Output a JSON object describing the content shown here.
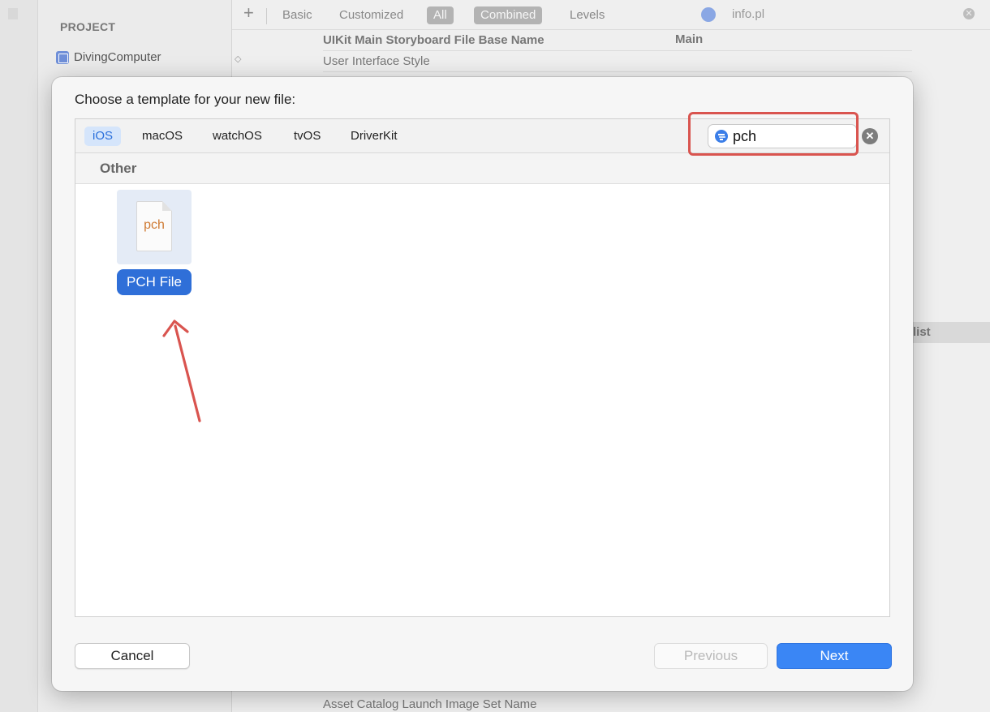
{
  "background": {
    "sidebar": {
      "header": "PROJECT",
      "project_item": "DivingComputer"
    },
    "toolbar": {
      "plus": "+",
      "tabs": [
        "Basic",
        "Customized",
        "All",
        "Combined",
        "Levels"
      ],
      "search_value": "info.pl"
    },
    "rows": {
      "storyboard_key": "UIKit Main Storyboard File Base Name",
      "storyboard_value": "Main",
      "ui_style": "User Interface Style",
      "selected_fragment": "list",
      "asset_catalog": "Asset Catalog Launch Image Set Name"
    }
  },
  "dialog": {
    "title": "Choose a template for your new file:",
    "platform_tabs": [
      "iOS",
      "macOS",
      "watchOS",
      "tvOS",
      "DriverKit"
    ],
    "selected_platform": "iOS",
    "search": {
      "value": "pch",
      "clear_glyph": "✕"
    },
    "section_header": "Other",
    "templates": [
      {
        "name": "PCH File",
        "ext": "pch",
        "selected": true
      }
    ],
    "buttons": {
      "cancel": "Cancel",
      "previous": "Previous",
      "next": "Next"
    }
  },
  "colors": {
    "accent": "#3a86f5",
    "selection": "#2f6fd8",
    "annotation": "#d9544f",
    "file_ext": "#cf7a33"
  },
  "icons": {
    "search_filter": "filter-circle-icon",
    "clear": "clear-circle-icon",
    "project": "app-project-icon",
    "file": "document-icon"
  }
}
